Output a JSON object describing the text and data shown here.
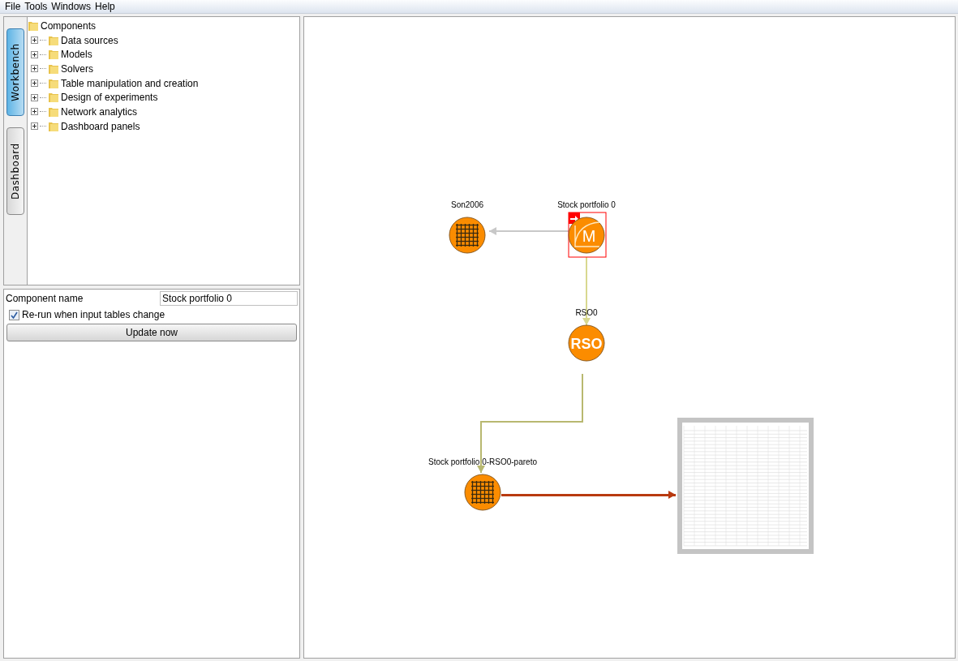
{
  "menu": [
    "File",
    "Tools",
    "Windows",
    "Help"
  ],
  "side_tabs": [
    {
      "label": "Workbench",
      "selected": true
    },
    {
      "label": "Dashboard",
      "selected": false
    }
  ],
  "tree": {
    "label": "Components",
    "children": [
      {
        "label": "Data sources",
        "expanded": false
      },
      {
        "label": "Models",
        "expanded": false
      },
      {
        "label": "Solvers",
        "expanded": false
      },
      {
        "label": "Table manipulation and creation",
        "expanded": false
      },
      {
        "label": "Design of experiments",
        "expanded": false
      },
      {
        "label": "Network analytics",
        "expanded": false
      },
      {
        "label": "Dashboard panels",
        "expanded": false
      }
    ]
  },
  "properties": {
    "name_label": "Component name",
    "name_value": "Stock portfolio 0",
    "rerun_label": "Re-run when input tables change",
    "rerun_checked": true,
    "update_button": "Update now"
  },
  "canvas": {
    "nodes": [
      {
        "kind": "grid",
        "label": "Son2006",
        "selected": false
      },
      {
        "kind": "model",
        "label": "Stock portfolio 0",
        "icon_text": "M",
        "selected": true
      },
      {
        "kind": "rso",
        "label": "RSO0",
        "icon_text": "RSO",
        "selected": false
      },
      {
        "kind": "grid",
        "label": "Stock portfolio 0-RSO0-pareto",
        "selected": false
      },
      {
        "kind": "table",
        "selected": false
      }
    ],
    "edges": [
      {
        "color": "#c8c8c8"
      },
      {
        "color": "#d8d890"
      },
      {
        "color": "#b8b870"
      },
      {
        "color": "#b83a10"
      }
    ]
  }
}
